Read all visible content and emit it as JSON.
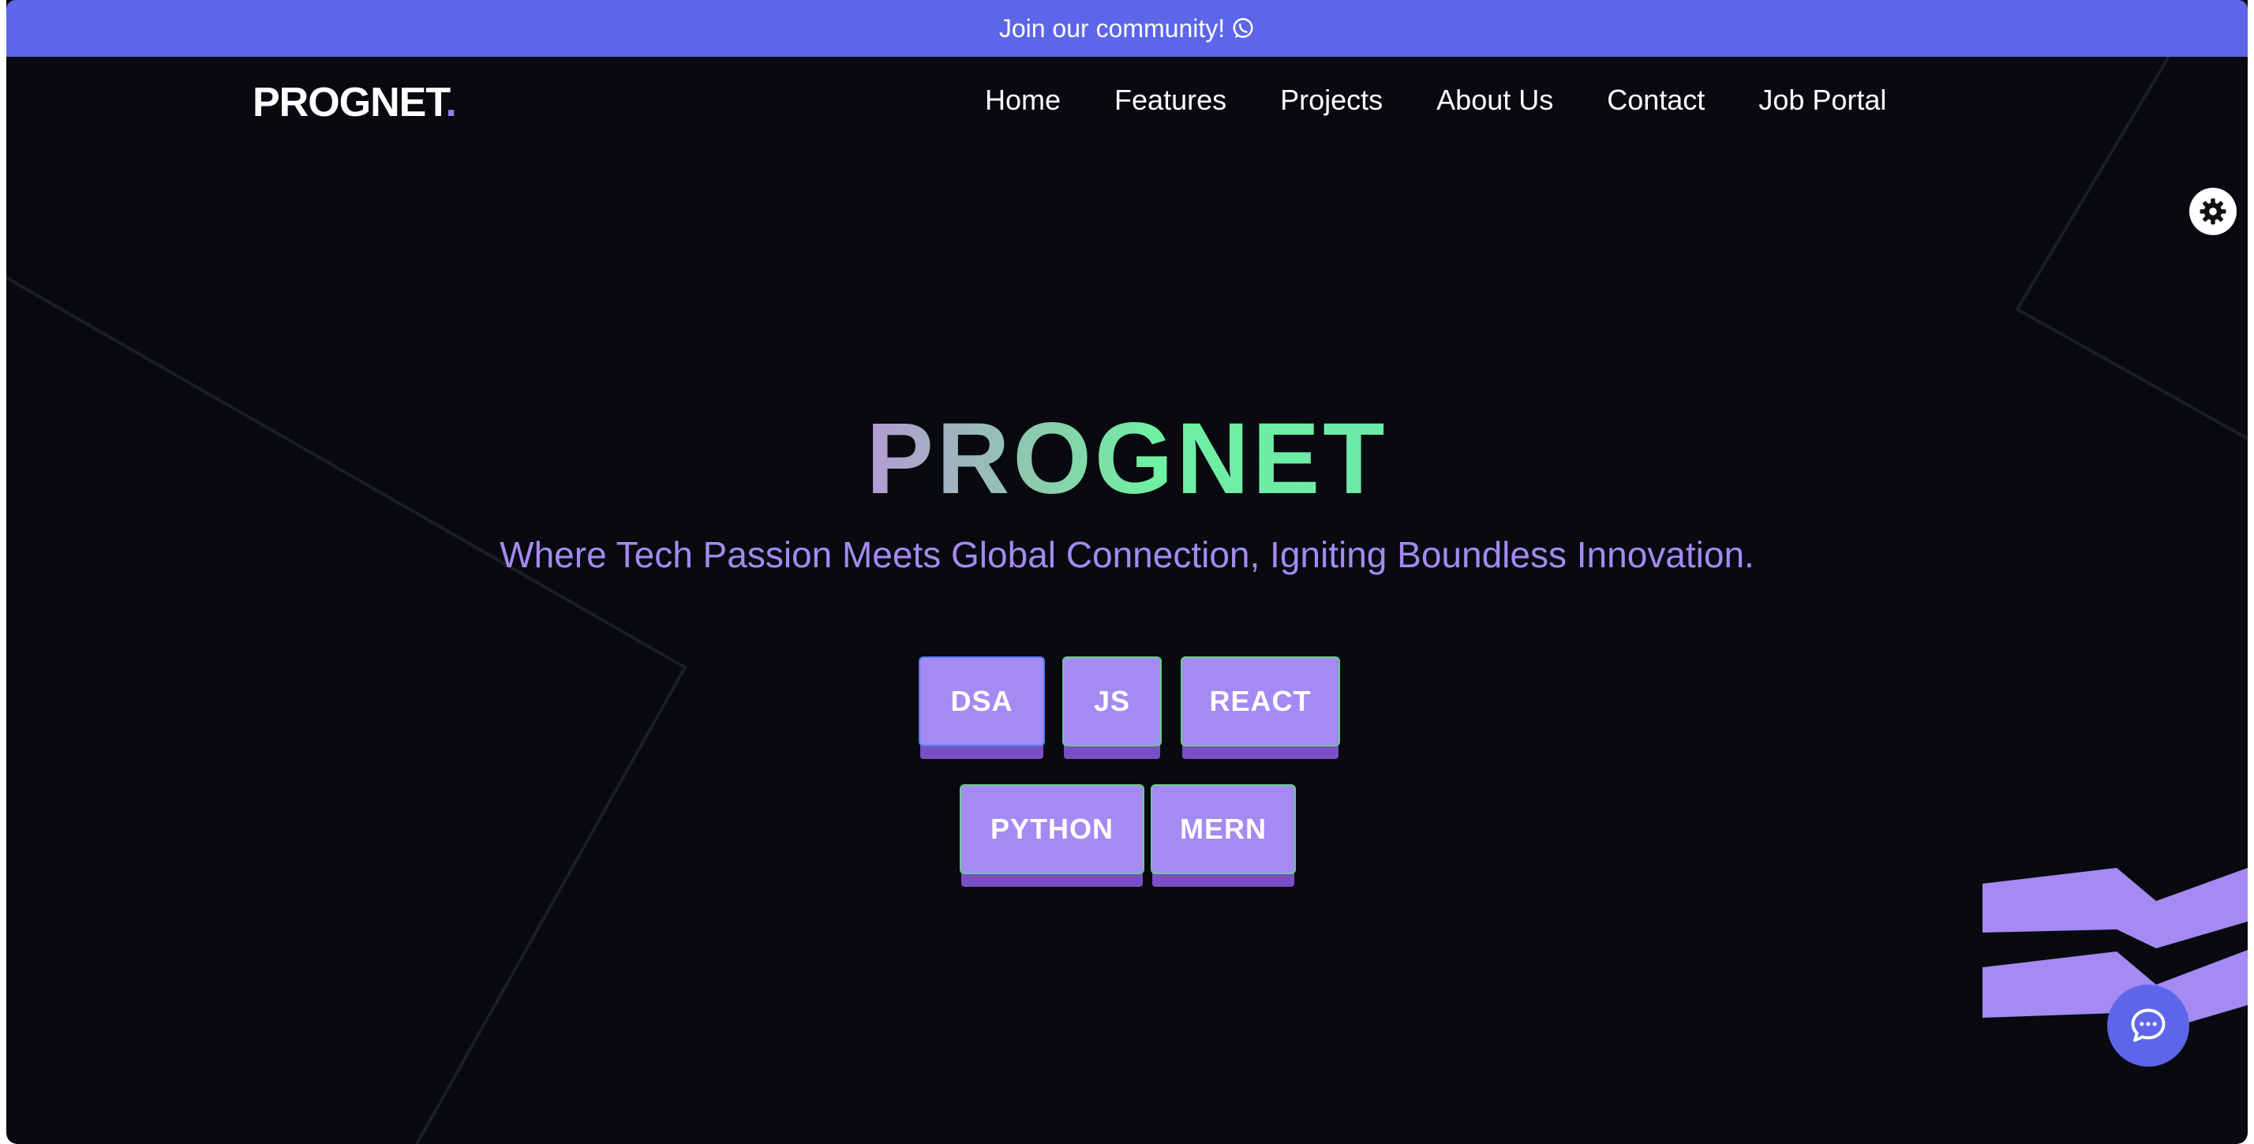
{
  "banner": {
    "text": "Join our community!",
    "icon": "whatsapp-icon"
  },
  "header": {
    "logo": "PROGNET",
    "logo_dot": ".",
    "nav": [
      "Home",
      "Features",
      "Projects",
      "About Us",
      "Contact",
      "Job Portal"
    ]
  },
  "settings": {
    "icon": "gear-icon"
  },
  "hero": {
    "title": "PROGNET",
    "subtitle": "Where Tech Passion Meets Global Connection, Igniting Boundless Innovation.",
    "tags": [
      "DSA",
      "JS",
      "REACT",
      "PYTHON",
      "MERN"
    ]
  },
  "chat": {
    "icon": "chat-bubble-icon"
  },
  "colors": {
    "banner": "#5d66e9",
    "background": "#080a10",
    "accent_purple": "#a48af2",
    "accent_green": "#6ff0a2"
  }
}
